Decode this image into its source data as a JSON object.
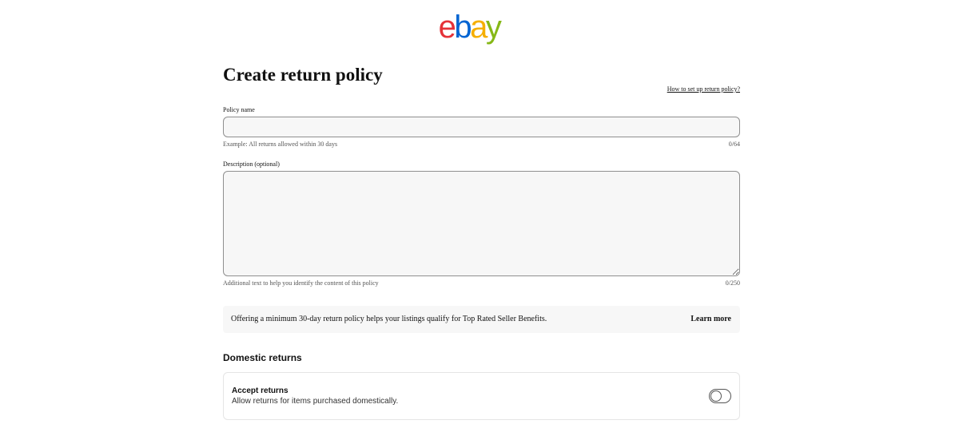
{
  "logo": {
    "letters": [
      "e",
      "b",
      "a",
      "y"
    ],
    "colors": [
      "#e53238",
      "#0064d2",
      "#f5af02",
      "#86b817"
    ]
  },
  "header": {
    "title": "Create return policy",
    "help_link": "How to set up return policy?"
  },
  "policy_name": {
    "label": "Policy name",
    "value": "",
    "placeholder": "",
    "helper": "Example: All returns allowed within 30 days",
    "counter": "0/64"
  },
  "description": {
    "label": "Description (optional)",
    "value": "",
    "placeholder": "",
    "helper": "Additional text to help you identify the content of this policy",
    "counter": "0/250"
  },
  "banner": {
    "text": "Offering a minimum 30-day return policy helps your listings qualify for Top Rated Seller Benefits.",
    "link": "Learn more"
  },
  "domestic_returns": {
    "heading": "Domestic returns",
    "accept_title": "Accept returns",
    "accept_subtitle": "Allow returns for items purchased domestically.",
    "toggle_on": false
  }
}
